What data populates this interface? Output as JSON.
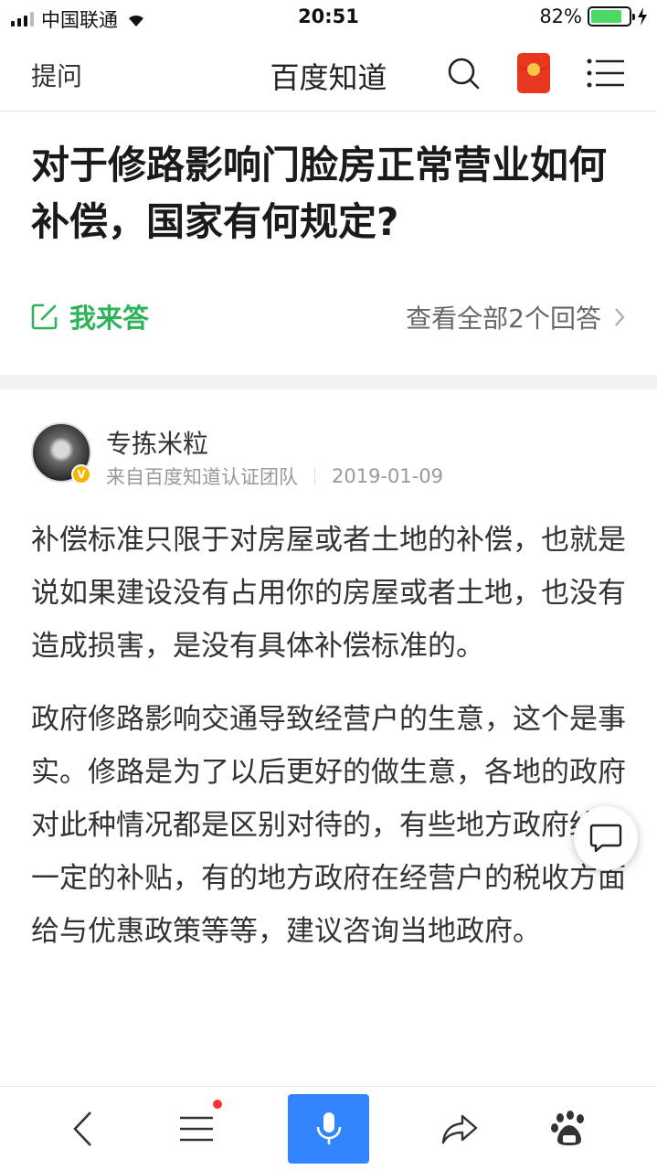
{
  "status_bar": {
    "carrier": "中国联通",
    "time": "20:51",
    "battery": "82%",
    "battery_level": 0.82
  },
  "header": {
    "ask": "提问",
    "title": "百度知道"
  },
  "question": {
    "title": "对于修路影响门脸房正常营业如何补偿，国家有何规定?",
    "answer_button": "我来答",
    "all_answers": "查看全部2个回答"
  },
  "answer": {
    "author": "专拣米粒",
    "source": "来自百度知道认证团队",
    "date": "2019-01-09",
    "paragraphs": [
      "补偿标准只限于对房屋或者土地的补偿，也就是说如果建设没有占用你的房屋或者土地，也没有造成损害，是没有具体补偿标准的。",
      "政府修路影响交通导致经营户的生意，这个是事实。修路是为了以后更好的做生意，各地的政府对此种情况都是区别对待的，有些地方政府给与一定的补贴，有的地方政府在经营户的税收方面给与优惠政策等等，建议咨询当地政府。"
    ]
  },
  "colors": {
    "accent_green": "#2eb35b",
    "mic_blue": "#3385ff",
    "redpacket": "#e8361f"
  }
}
